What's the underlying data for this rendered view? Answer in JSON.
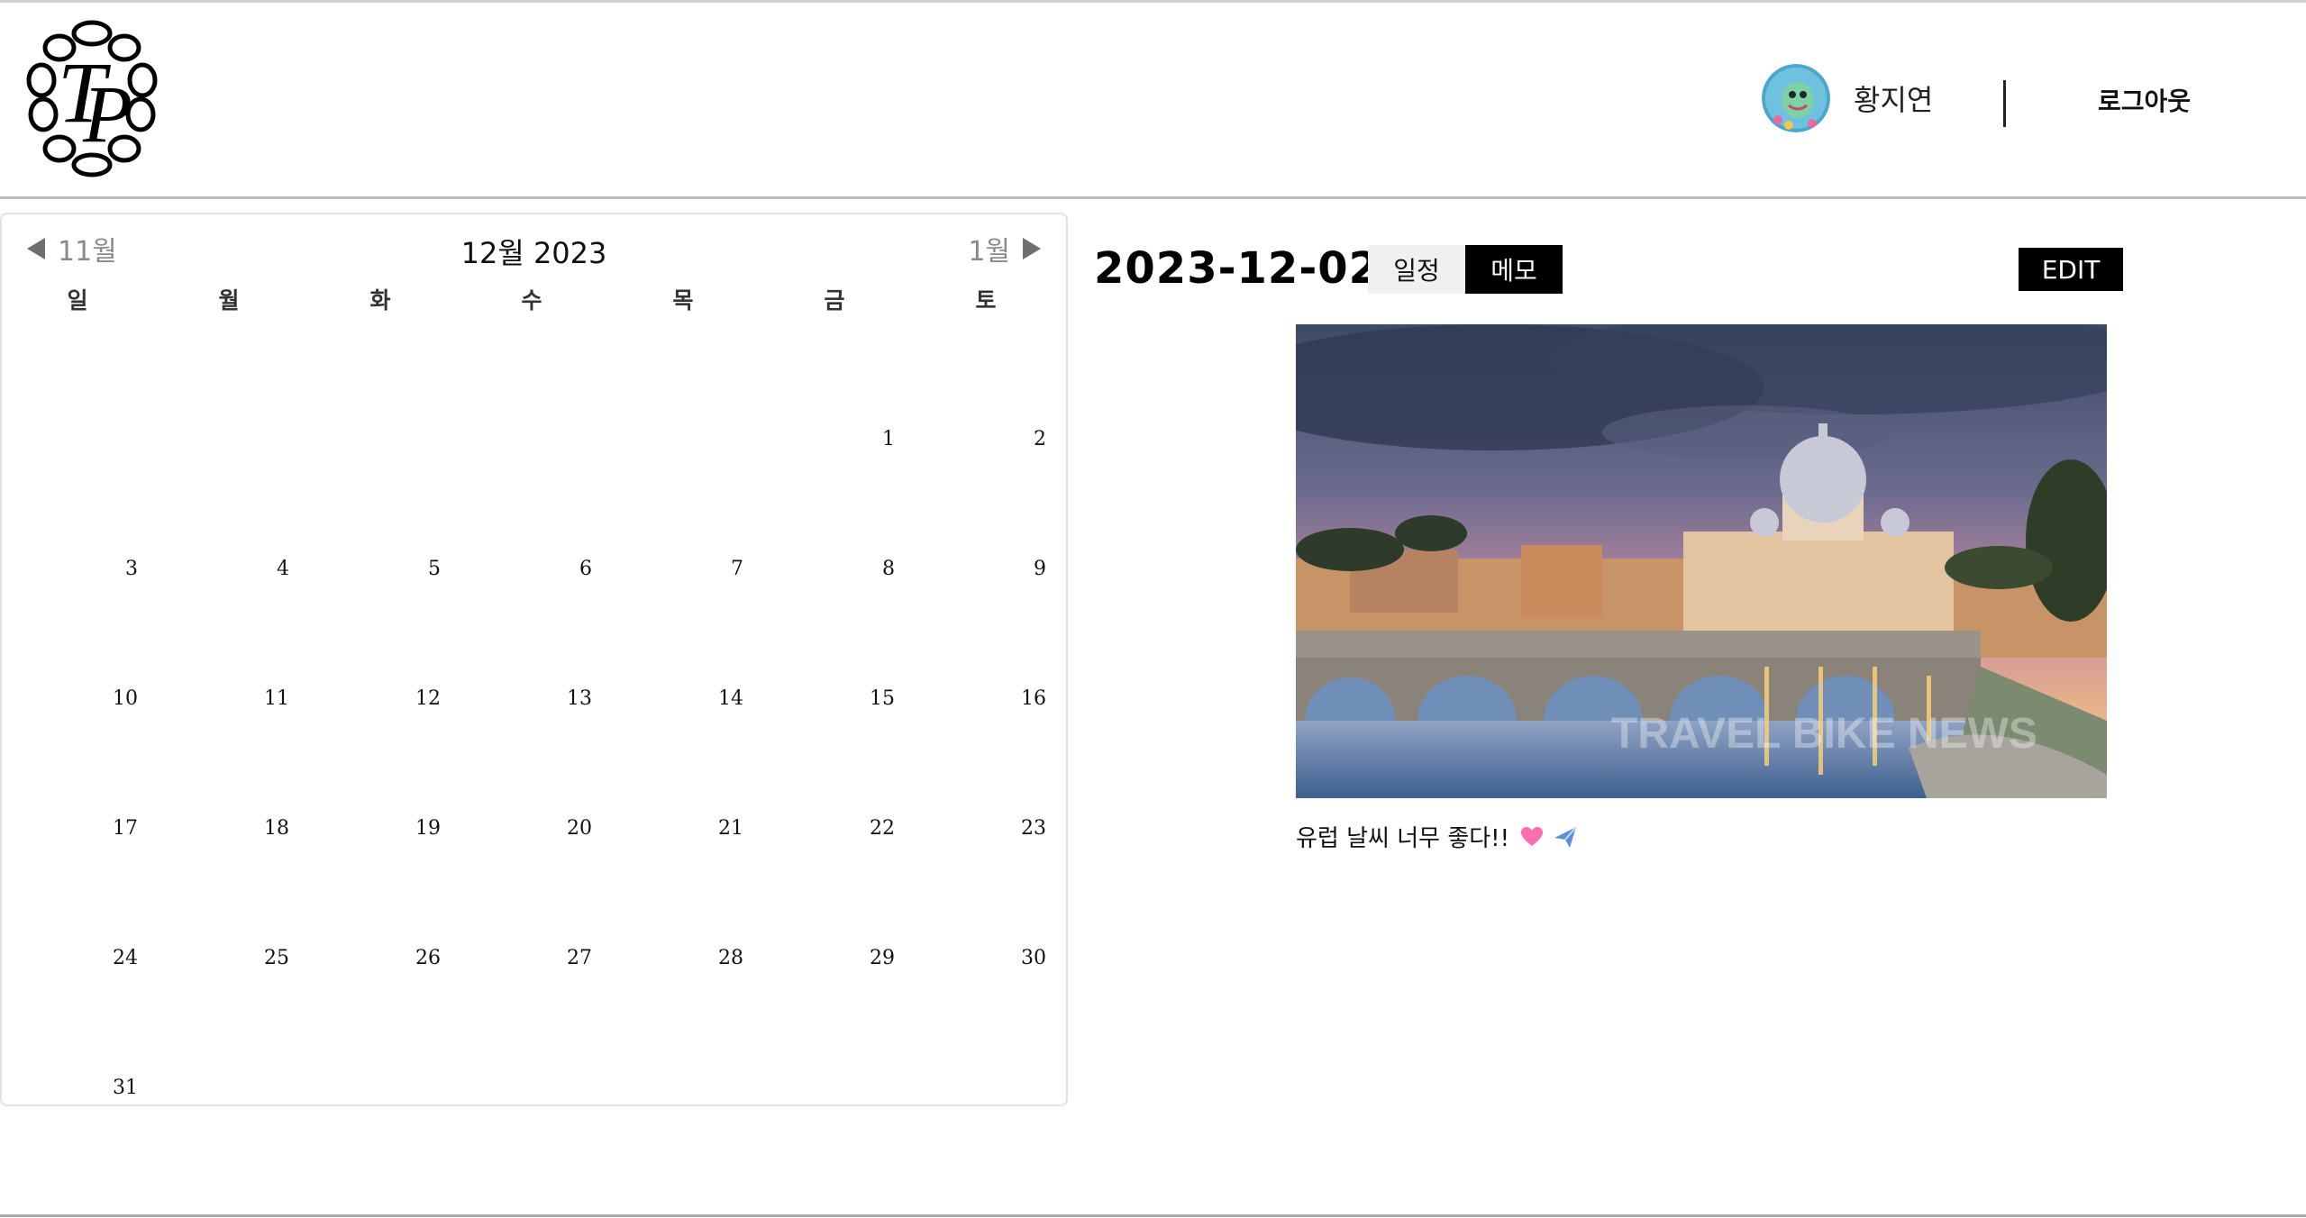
{
  "header": {
    "user_name": "황지연",
    "logout_label": "로그아웃"
  },
  "calendar": {
    "prev_label": "11월",
    "next_label": "1월",
    "title": "12월 2023",
    "weekdays": [
      "일",
      "월",
      "화",
      "수",
      "목",
      "금",
      "토"
    ],
    "leading_blank_days": 5,
    "days": [
      "1",
      "2",
      "3",
      "4",
      "5",
      "6",
      "7",
      "8",
      "9",
      "10",
      "11",
      "12",
      "13",
      "14",
      "15",
      "16",
      "17",
      "18",
      "19",
      "20",
      "21",
      "22",
      "23",
      "24",
      "25",
      "26",
      "27",
      "28",
      "29",
      "30",
      "31"
    ]
  },
  "detail": {
    "date": "2023-12-02",
    "tabs": [
      {
        "label": "일정",
        "active": false
      },
      {
        "label": "메모",
        "active": true
      }
    ],
    "edit_label": "EDIT",
    "photo_icon": "rome-cityscape-photo",
    "photo_watermark": "TRAVEL BIKE NEWS",
    "memo_text": "유럽 날씨 너무 좋다!!",
    "memo_icons": [
      "heart-icon",
      "airplane-icon"
    ]
  },
  "colors": {
    "accent": "#000000",
    "tab_inactive_bg": "#f0f0f0",
    "heart": "#ff6fae",
    "plane": "#5b8fd6"
  }
}
